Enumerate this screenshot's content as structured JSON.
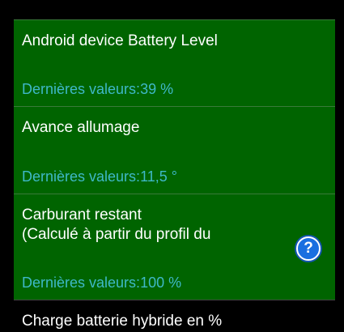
{
  "sensors": [
    {
      "name_lines": [
        "Android device Battery Level"
      ],
      "value_label": "Dernières valeurs:",
      "value": "39",
      "unit": " %"
    },
    {
      "name_lines": [
        "Avance allumage"
      ],
      "value_label": "Dernières valeurs:",
      "value": "11,5",
      "unit": " °"
    },
    {
      "name_lines": [
        "Carburant restant",
        "(Calculé à partir du profil du"
      ],
      "value_label": "Dernières valeurs:",
      "value": "100",
      "unit": " %",
      "help_icon": "question-mark-icon",
      "help_glyph": "?"
    }
  ],
  "partial_item": {
    "name": "Charge batterie hybride en %"
  },
  "colors": {
    "item_background": "#006400",
    "value_text": "#3fb8c8",
    "name_text": "#ffffff",
    "screen_background": "#000000",
    "help_icon": "#1a6fe0"
  }
}
